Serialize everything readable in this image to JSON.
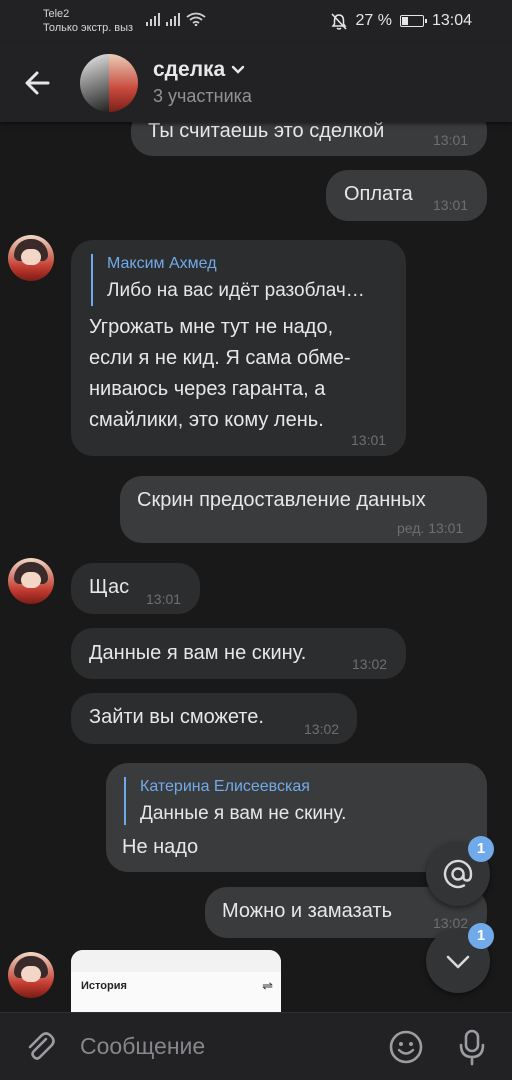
{
  "status_bar": {
    "carrier": "Tele2",
    "carrier_sub": "Только экстр. выз",
    "battery": "27 %",
    "time": "13:04"
  },
  "header": {
    "title": "сделка",
    "subtitle": "3 участника"
  },
  "messages": {
    "m1": {
      "text": "Ты считаешь это сделкой",
      "time": "13:01"
    },
    "m2": {
      "text": "Оплата",
      "time": "13:01"
    },
    "m3": {
      "quote_author": "Максим Ахмед",
      "quote_text": "Либо на вас идёт разоблач…",
      "lines": [
        "Угрожать мне тут не надо,",
        "если я не кид. Я сама обме-",
        "ниваюсь через гаранта, а",
        "смайлики, это кому лень."
      ],
      "time": "13:01"
    },
    "m4": {
      "text": "Скрин предоставление данных",
      "time": "ред. 13:01"
    },
    "m5": {
      "text": "Щас",
      "time": "13:01"
    },
    "m6": {
      "text": "Данные я вам не скину.",
      "time": "13:02"
    },
    "m7": {
      "text": "Зайти вы сможете.",
      "time": "13:02"
    },
    "m8": {
      "quote_author": "Катерина Елисеевская",
      "quote_text": "Данные я вам не скину.",
      "text": "Не надо"
    },
    "m9": {
      "text": "Можно и замазать",
      "time": "13:02"
    }
  },
  "preview": {
    "title": "История"
  },
  "fabs": {
    "mention_badge": "1",
    "scroll_badge": "1"
  },
  "composer": {
    "placeholder": "Сообщение"
  },
  "colors": {
    "accent": "#71aaeb",
    "background": "#19191a",
    "bubble_in": "#2c2d2e",
    "bubble_out": "#3a3b3d"
  }
}
